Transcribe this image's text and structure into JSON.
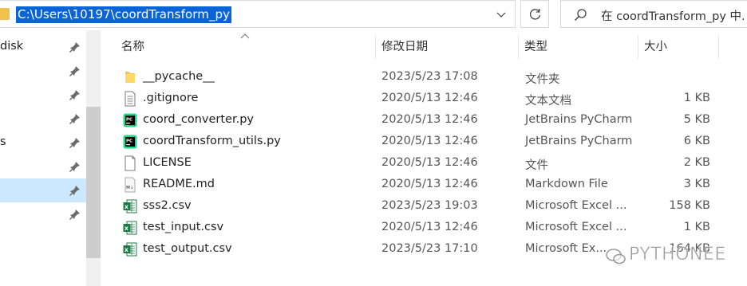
{
  "address_bar": {
    "path": "C:\\Users\\10197\\coordTransform_py"
  },
  "search": {
    "placeholder": "在 coordTransform_py 中."
  },
  "nav": {
    "items": [
      {
        "label": "disk"
      },
      {
        "label": ""
      },
      {
        "label": ""
      },
      {
        "label": ""
      },
      {
        "label": "s"
      },
      {
        "label": ""
      },
      {
        "label": ""
      },
      {
        "label": ""
      }
    ]
  },
  "columns": {
    "name": "名称",
    "date": "修改日期",
    "type": "类型",
    "size": "大小"
  },
  "files": [
    {
      "name": "__pycache__",
      "date": "2023/5/23 17:08",
      "type": "文件夹",
      "size": "",
      "icon": "folder-icon"
    },
    {
      "name": ".gitignore",
      "date": "2020/5/13 12:46",
      "type": "文本文档",
      "size": "1 KB",
      "icon": "text-file-icon"
    },
    {
      "name": "coord_converter.py",
      "date": "2020/5/13 12:46",
      "type": "JetBrains PyCharm",
      "size": "5 KB",
      "icon": "pycharm-file-icon"
    },
    {
      "name": "coordTransform_utils.py",
      "date": "2020/5/13 12:46",
      "type": "JetBrains PyCharm",
      "size": "6 KB",
      "icon": "pycharm-file-icon"
    },
    {
      "name": "LICENSE",
      "date": "2020/5/13 12:46",
      "type": "文件",
      "size": "2 KB",
      "icon": "blank-file-icon"
    },
    {
      "name": "README.md",
      "date": "2020/5/13 12:46",
      "type": "Markdown File",
      "size": "3 KB",
      "icon": "markdown-file-icon"
    },
    {
      "name": "sss2.csv",
      "date": "2023/5/23 19:03",
      "type": "Microsoft Excel ...",
      "size": "158 KB",
      "icon": "excel-file-icon"
    },
    {
      "name": "test_input.csv",
      "date": "2020/5/13 12:46",
      "type": "Microsoft Excel ...",
      "size": "1 KB",
      "icon": "excel-file-icon"
    },
    {
      "name": "test_output.csv",
      "date": "2023/5/23 17:10",
      "type": "Microsoft Ex...",
      "size": "164 KB",
      "icon": "excel-file-icon"
    }
  ],
  "watermark": {
    "text": "PYTHONEE"
  },
  "colors": {
    "selection": "#0a64d6",
    "nav_selected": "#cce8ff",
    "folder": "#f0c24a",
    "excel": "#1d7a45",
    "pycharm_green": "#21d789"
  }
}
